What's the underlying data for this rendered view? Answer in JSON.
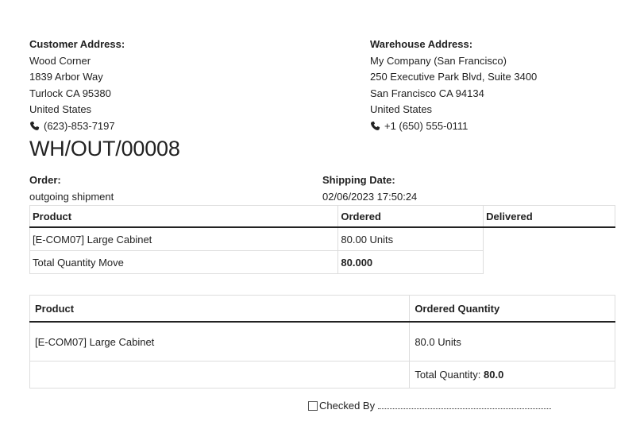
{
  "customer": {
    "heading": "Customer Address:",
    "name": "Wood Corner",
    "street": "1839 Arbor Way",
    "city": "Turlock CA 95380",
    "country": "United States",
    "phone": "(623)-853-7197"
  },
  "warehouse": {
    "heading": "Warehouse Address:",
    "name": "My Company (San Francisco)",
    "street": "250 Executive Park Blvd, Suite 3400",
    "city": "San Francisco CA 94134",
    "country": "United States",
    "phone": "+1 (650) 555-0111"
  },
  "reference": "WH/OUT/00008",
  "order": {
    "label": "Order:",
    "value": "outgoing shipment"
  },
  "shipping_date": {
    "label": "Shipping Date:",
    "value": "02/06/2023 17:50:24"
  },
  "moves_table": {
    "headers": [
      "Product",
      "Ordered",
      "Delivered"
    ],
    "row": {
      "product": "[E-COM07] Large Cabinet",
      "ordered": "80.00 Units"
    },
    "total": {
      "label": "Total Quantity Move",
      "value": "80.000"
    }
  },
  "summary_table": {
    "headers": [
      "Product",
      "Ordered Quantity"
    ],
    "row": {
      "product": "[E-COM07] Large Cabinet",
      "quantity": "80.0 Units"
    },
    "total": {
      "label": "Total Quantity:",
      "value": "80.0"
    }
  },
  "checked_by": "Checked By",
  "icons": {
    "phone": "phone-icon",
    "checkbox": "checkbox-icon"
  }
}
